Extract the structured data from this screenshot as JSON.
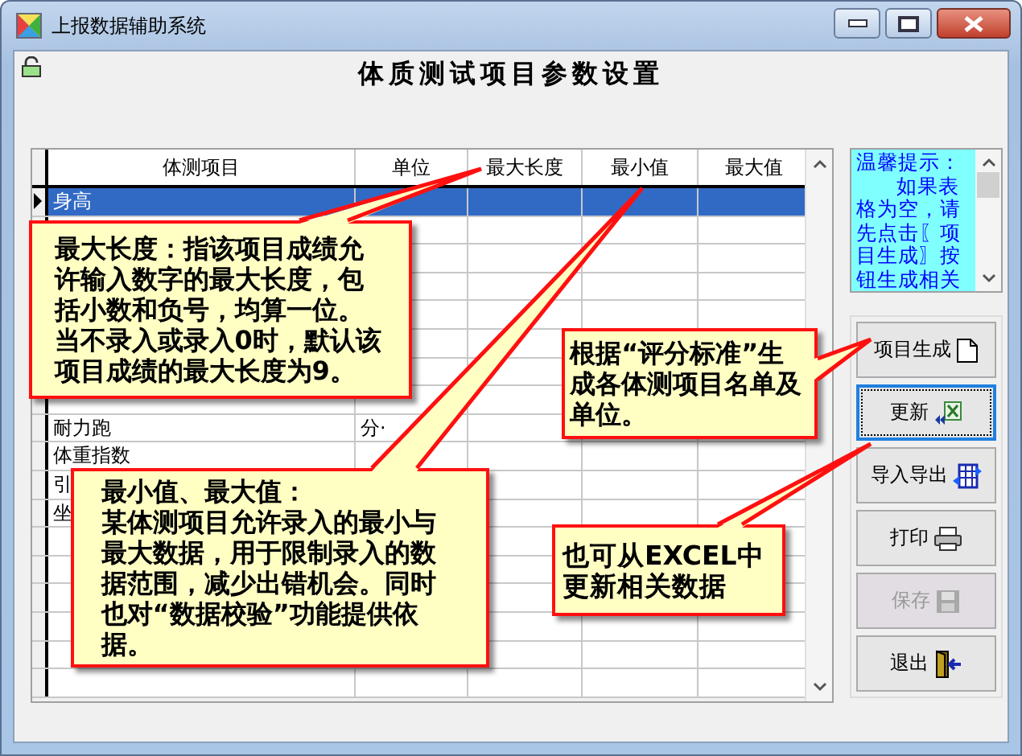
{
  "window": {
    "title": "上报数据辅助系统"
  },
  "heading": "体质测试项目参数设置",
  "table": {
    "columns": [
      "体测项目",
      "单位",
      "最大长度",
      "最小值",
      "最大值"
    ],
    "rows": [
      {
        "name": "身高",
        "selected": true
      },
      {
        "selected": false
      },
      {
        "selected": false
      },
      {
        "selected": false
      },
      {
        "selected": false
      },
      {
        "selected": false
      },
      {
        "selected": false
      },
      {
        "selected": false
      },
      {
        "name": "耐力跑",
        "unit": "分·",
        "selected": false
      },
      {
        "name": "体重指数",
        "selected": false
      },
      {
        "name": "引",
        "selected": false
      },
      {
        "name": "坐",
        "selected": false
      }
    ]
  },
  "tip": {
    "title": "温馨提示：",
    "text": "如果表格为空，请先点击〖项目生成〗按钮生成相关"
  },
  "buttons": [
    {
      "label": "项目生成",
      "disabled": false,
      "focused": false
    },
    {
      "label": "更新",
      "disabled": false,
      "focused": true
    },
    {
      "label": "导入导出",
      "disabled": false,
      "focused": false
    },
    {
      "label": "打印",
      "disabled": false,
      "focused": false
    },
    {
      "label": "保存",
      "disabled": true,
      "focused": false
    },
    {
      "label": "退出",
      "disabled": false,
      "focused": false
    }
  ],
  "callouts": [
    {
      "text": "最大长度：指该项目成绩允许输入数字的最大长度，包括小数和负号，均算一位。当不录入或录入0时，默认该项目成绩的最大长度为9。"
    },
    {
      "title": "最小值、最大值：",
      "text": "某体测项目允许录入的最小与最大数据，用于限制录入的数据范围，减少出错机会。同时也对“数据校验”功能提供依据。"
    },
    {
      "text": "根据“评分标准”生成各体测项目名单及单位。"
    },
    {
      "text": "也可从EXCEL中更新相关数据"
    }
  ]
}
